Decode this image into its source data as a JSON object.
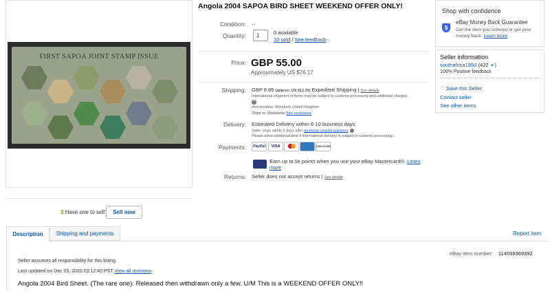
{
  "title": "Angola 2004 SAPOA BIRD SHEET WEEKEND OFFER ONLY!",
  "image": {
    "stamp_title": "FIRST SAPOA JOINT STAMP ISSUE"
  },
  "condition": {
    "label": "Condition:",
    "value": "--"
  },
  "quantity": {
    "label": "Quantity:",
    "value": "1",
    "available": "0 available",
    "sold": "10 sold",
    "sep": " / ",
    "feedback": "See feedback"
  },
  "price": {
    "label": "Price:",
    "value": "GBP 55.00",
    "approx": "Approximately US $76.17"
  },
  "shipping": {
    "label": "Shipping:",
    "cost": "GBP 8.95",
    "approx": "(approx. US $12.39)",
    "service": "Expedited Shipping |",
    "details": "See details",
    "intl_note": "International shipment of items may be subject to customs processing and additional charges.",
    "location": "Item location: Winsford, United Kingdom",
    "ships_to": "Ships to: Worldwide",
    "exclusions": "See exclusions"
  },
  "delivery": {
    "label": "Delivery:",
    "estimate": "Estimated Delivery within 6-10 business days",
    "note1": "Seller ships within 3 days after",
    "note_link": "receiving cleared payment",
    "note2": "Please allow additional time if international delivery is subject to customs processing."
  },
  "payments": {
    "label": "Payments:",
    "icons": [
      "PayPal",
      "VISA",
      "MC",
      "AMEX",
      "DISCOVER"
    ],
    "promo": "Earn up to 5x points when you use your eBay Mastercard®.",
    "promo_link": "Learn more"
  },
  "returns": {
    "label": "Returns:",
    "value": "Seller does not accept returns |",
    "details": "See details"
  },
  "confidence": {
    "heading": "Shop with confidence",
    "guarantee_title": "eBay Money Back Guarantee",
    "guarantee_text": "Get the item you ordered or get your money back.",
    "learn_more": "Learn more"
  },
  "seller": {
    "heading": "Seller information",
    "name": "southafrica1950",
    "score": "(422",
    "score_end": ")",
    "positive": "100% Positive feedback",
    "save": "Save this Seller",
    "contact": "Contact seller",
    "other": "See other items"
  },
  "sell_prompt": {
    "text": "Have one to sell?",
    "button": "Sell now"
  },
  "tabs": {
    "description": "Description",
    "shipping": "Shipping and payments",
    "report": "Report item"
  },
  "description": {
    "item_number_label": "eBay item number:",
    "item_number": "114559369392",
    "responsibility": "Seller assumes all responsibility for this listing.",
    "updated_label": "Last updated on  Dec 05, 2020 03:12:40 PST",
    "revisions": "View all revisions",
    "body": "Angola 2004 Bird Sheet. (The rare one). Released then withdrawn only a few. U/M This is a WEEKEND OFFER ONLY!!"
  },
  "colors": {
    "link": "#0654ba",
    "star": "#2aa4d9",
    "shield": "#3665f3"
  }
}
